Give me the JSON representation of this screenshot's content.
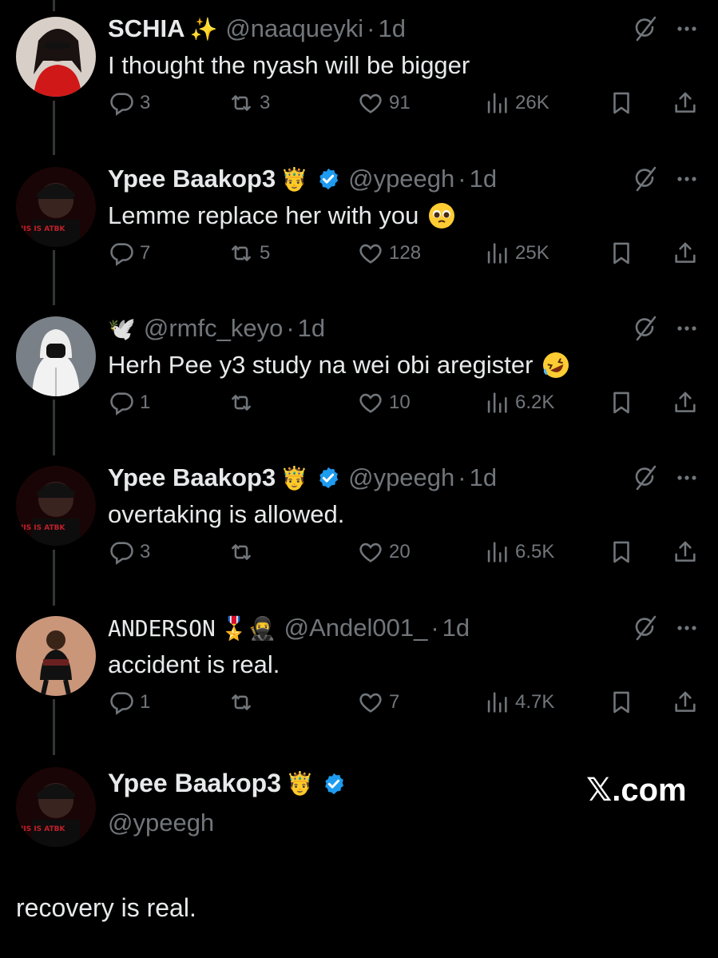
{
  "replies": [
    {
      "name": "SCHIA",
      "name_emoji": "✨",
      "handle": "@naaqueyki",
      "time": "1d",
      "verified": false,
      "text": "I thought the nyash will be bigger",
      "text_emoji": "",
      "replies": "3",
      "reposts": "3",
      "likes": "91",
      "views": "26K"
    },
    {
      "name": "Ypee Baakop3",
      "name_emoji": "🤴",
      "handle": "@ypeegh",
      "time": "1d",
      "verified": true,
      "text": "Lemme replace her with you",
      "text_emoji": "pleading-face",
      "replies": "7",
      "reposts": "5",
      "likes": "128",
      "views": "25K"
    },
    {
      "name": "",
      "name_emoji": "🕊️",
      "handle": "@rmfc_keyo",
      "time": "1d",
      "verified": false,
      "text": "Herh Pee y3 study na wei obi aregister",
      "text_emoji": "rofl-face",
      "replies": "1",
      "reposts": "",
      "likes": "10",
      "views": "6.2K"
    },
    {
      "name": "Ypee Baakop3",
      "name_emoji": "🤴",
      "handle": "@ypeegh",
      "time": "1d",
      "verified": true,
      "text": "overtaking is allowed.",
      "text_emoji": "",
      "replies": "3",
      "reposts": "",
      "likes": "20",
      "views": "6.5K"
    },
    {
      "name": "ANDERSON",
      "name_emoji": "🎖️🥷",
      "handle": "@Andel001_",
      "time": "1d",
      "verified": false,
      "text": "accident is real.",
      "text_emoji": "",
      "replies": "1",
      "reposts": "",
      "likes": "7",
      "views": "4.7K"
    }
  ],
  "main_tweet": {
    "name": "Ypee Baakop3",
    "name_emoji": "🤴",
    "handle": "@ypeegh",
    "verified": true,
    "text": "recovery is real."
  },
  "watermark": "𝕏.com",
  "colors": {
    "background": "#000000",
    "text": "#e7e9ea",
    "muted": "#71767b",
    "verified": "#1d9bf0"
  }
}
